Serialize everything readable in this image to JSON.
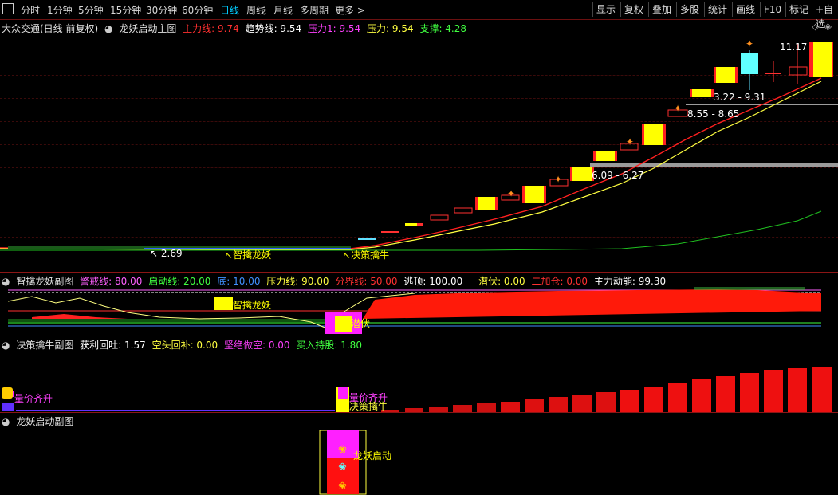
{
  "toolbar": {
    "periods": [
      "分时",
      "1分钟",
      "5分钟",
      "15分钟",
      "30分钟",
      "60分钟",
      "日线",
      "周线",
      "月线",
      "多周期",
      "更多"
    ],
    "active_period": "日线",
    "right_buttons": [
      "显示",
      "复权",
      "叠加",
      "多股",
      "统计",
      "画线",
      "F10",
      "标记",
      "+自选"
    ]
  },
  "main_panel": {
    "stock_title": "大众交通(日线 前复权)",
    "indicator_name": "龙妖启动主图",
    "values": [
      {
        "label": "主力线: 9.74",
        "color": "#ff3030"
      },
      {
        "label": "趋势线: 9.54",
        "color": "#ffffff"
      },
      {
        "label": "压力1: 9.54",
        "color": "#ff40ff"
      },
      {
        "label": "压力: 9.54",
        "color": "#ffff40"
      },
      {
        "label": "支撑: 4.28",
        "color": "#40ff40"
      }
    ],
    "annotations": {
      "high": "11.17",
      "low": "2.69",
      "range1": "3.22 - 9.31",
      "range2": "8.55 - 8.65",
      "range3": "6.09 - 6.27",
      "signal1": "智擒龙妖",
      "signal2": "决策擒牛"
    }
  },
  "sub1": {
    "name": "智擒龙妖副图",
    "values": [
      {
        "label": "警戒线: 80.00",
        "color": "#ff60ff"
      },
      {
        "label": "启动线: 20.00",
        "color": "#40ff40"
      },
      {
        "label": "底: 10.00",
        "color": "#4090ff"
      },
      {
        "label": "压力线: 90.00",
        "color": "#ffff40"
      },
      {
        "label": "分界线: 50.00",
        "color": "#ff3030"
      },
      {
        "label": "逃顶: 100.00",
        "color": "#ffffff"
      },
      {
        "label": "一潜伏: 0.00",
        "color": "#ffff40"
      },
      {
        "label": "二加仓: 0.00",
        "color": "#ff3030"
      },
      {
        "label": "主力动能: 99.30",
        "color": "#ffffff"
      }
    ],
    "signal1": "智擒龙妖",
    "signal2": "潜伏"
  },
  "sub2": {
    "name": "决策擒牛副图",
    "values": [
      {
        "label": "获利回吐: 1.57",
        "color": "#ffffff"
      },
      {
        "label": "空头回补: 0.00",
        "color": "#ffff40"
      },
      {
        "label": "坚绝做空: 0.00",
        "color": "#ff40ff"
      },
      {
        "label": "买入持股: 1.80",
        "color": "#40ff40"
      }
    ],
    "signal1": "量价齐升",
    "signal2": "量价齐升",
    "signal3": "决策擒牛"
  },
  "sub3": {
    "name": "龙妖启动副图",
    "signal": "龙妖启动"
  }
}
